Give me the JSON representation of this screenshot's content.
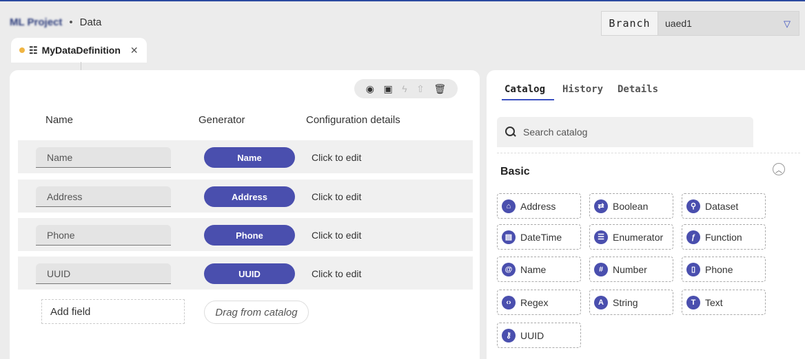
{
  "header": {
    "project": "ML Project",
    "separator": "•",
    "page": "Data",
    "branch_label": "Branch",
    "branch_value": "uaed1"
  },
  "tab": {
    "label": "MyDataDefinition"
  },
  "toolbar": {
    "icons": [
      "eye-icon",
      "save-icon",
      "bolt-icon",
      "upload-icon",
      "trash-icon"
    ]
  },
  "table": {
    "columns": [
      "Name",
      "Generator",
      "Configuration details"
    ],
    "rows": [
      {
        "name": "Name",
        "generator": "Name",
        "config": "Click to edit"
      },
      {
        "name": "Address",
        "generator": "Address",
        "config": "Click to edit"
      },
      {
        "name": "Phone",
        "generator": "Phone",
        "config": "Click to edit"
      },
      {
        "name": "UUID",
        "generator": "UUID",
        "config": "Click to edit"
      }
    ],
    "add_field": "Add field",
    "drag_from_catalog": "Drag from catalog"
  },
  "catalog": {
    "tabs": [
      "Catalog",
      "History",
      "Details"
    ],
    "active_tab": "Catalog",
    "search_placeholder": "Search catalog",
    "section_title": "Basic",
    "items": [
      {
        "label": "Address",
        "icon": "home-icon"
      },
      {
        "label": "Boolean",
        "icon": "toggle-icon"
      },
      {
        "label": "Dataset",
        "icon": "dataset-icon"
      },
      {
        "label": "DateTime",
        "icon": "calendar-icon"
      },
      {
        "label": "Enumerator",
        "icon": "list-icon"
      },
      {
        "label": "Function",
        "icon": "function-icon"
      },
      {
        "label": "Name",
        "icon": "at-icon"
      },
      {
        "label": "Number",
        "icon": "hash-icon"
      },
      {
        "label": "Phone",
        "icon": "phone-icon"
      },
      {
        "label": "Regex",
        "icon": "code-icon"
      },
      {
        "label": "String",
        "icon": "string-icon"
      },
      {
        "label": "Text",
        "icon": "text-icon"
      },
      {
        "label": "UUID",
        "icon": "key-icon"
      }
    ]
  },
  "colors": {
    "accent": "#4a4fae",
    "tab_dot": "#f0b543",
    "underline": "#3a4fc0"
  }
}
